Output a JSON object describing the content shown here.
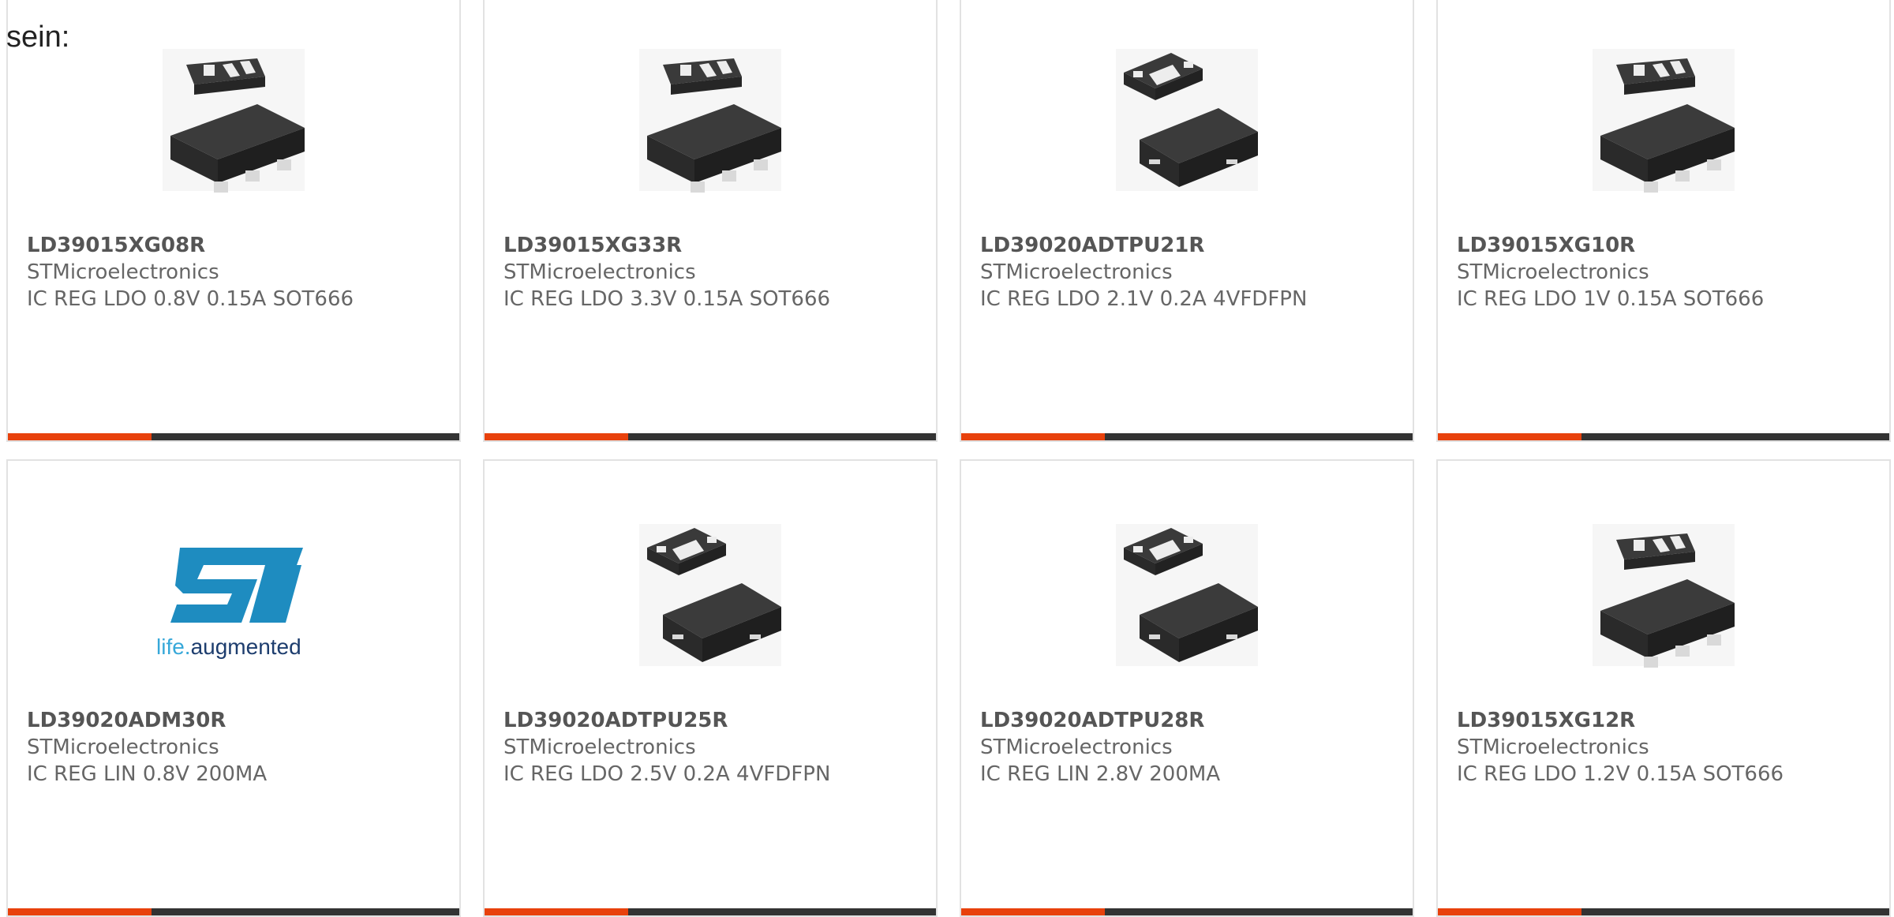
{
  "lead_text": "sein:",
  "colors": {
    "accent": "#e8410c",
    "bar": "#333333",
    "card_border": "#e2e2e2",
    "st_logo_blue": "#1e8cc0",
    "st_tagline_dark": "#1d3d6e",
    "st_tagline_light": "#37a8d9"
  },
  "logo_text": {
    "tagline_light": "life.",
    "tagline_dark": "augmented"
  },
  "products": [
    {
      "part_number": "LD39015XG08R",
      "manufacturer": "STMicroelectronics",
      "description": "IC REG LDO 0.8V 0.15A SOT666",
      "image": "sot666-chip-icon"
    },
    {
      "part_number": "LD39015XG33R",
      "manufacturer": "STMicroelectronics",
      "description": "IC REG LDO 3.3V 0.15A SOT666",
      "image": "sot666-chip-icon"
    },
    {
      "part_number": "LD39020ADTPU21R",
      "manufacturer": "STMicroelectronics",
      "description": "IC REG LDO 2.1V 0.2A 4VFDFPN",
      "image": "dfn-chip-icon"
    },
    {
      "part_number": "LD39015XG10R",
      "manufacturer": "STMicroelectronics",
      "description": "IC REG LDO 1V 0.15A SOT666",
      "image": "sot666-chip-icon"
    },
    {
      "part_number": "LD39020ADM30R",
      "manufacturer": "STMicroelectronics",
      "description": "IC REG LIN 0.8V 200MA",
      "image": "st-logo"
    },
    {
      "part_number": "LD39020ADTPU25R",
      "manufacturer": "STMicroelectronics",
      "description": "IC REG LDO 2.5V 0.2A 4VFDFPN",
      "image": "dfn-chip-icon"
    },
    {
      "part_number": "LD39020ADTPU28R",
      "manufacturer": "STMicroelectronics",
      "description": "IC REG LIN 2.8V 200MA",
      "image": "dfn-chip-icon"
    },
    {
      "part_number": "LD39015XG12R",
      "manufacturer": "STMicroelectronics",
      "description": "IC REG LDO 1.2V 0.15A SOT666",
      "image": "sot666-chip-icon"
    }
  ]
}
